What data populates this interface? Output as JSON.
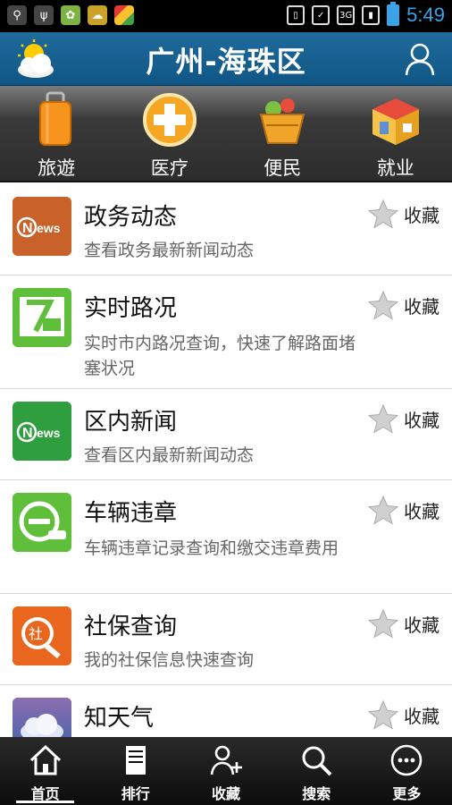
{
  "status_bar": {
    "time": "5:49"
  },
  "header": {
    "title": "广州-海珠区"
  },
  "categories": [
    {
      "label": "旅遊",
      "icon": "luggage-icon"
    },
    {
      "label": "医疗",
      "icon": "medical-cross-icon"
    },
    {
      "label": "便民",
      "icon": "basket-icon"
    },
    {
      "label": "就业",
      "icon": "shop-icon"
    }
  ],
  "list": {
    "fav_label": "收藏",
    "items": [
      {
        "title": "政务动态",
        "desc": "查看政务最新新闻动态",
        "icon": "news-icon",
        "color": "#d2691e"
      },
      {
        "title": "实时路况",
        "desc": "实时市内路况查询，快速了解路面堵塞状况",
        "icon": "traffic-map-icon",
        "color": "#5fbf3a"
      },
      {
        "title": "区内新闻",
        "desc": "查看区内最新新闻动态",
        "icon": "news-icon",
        "color": "#2e9e3e"
      },
      {
        "title": "车辆违章",
        "desc": "车辆违章记录查询和缴交违章费用",
        "icon": "car-violation-icon",
        "color": "#5fbf3a"
      },
      {
        "title": "社保查询",
        "desc": "我的社保信息快速查询",
        "icon": "social-security-icon",
        "color": "#e8661e"
      },
      {
        "title": "知天气",
        "desc": "",
        "icon": "weather-icon",
        "color": "#4a5fa8"
      }
    ]
  },
  "bottom_nav": [
    {
      "label": "首页",
      "icon": "home-icon",
      "active": true
    },
    {
      "label": "排行",
      "icon": "ranking-icon",
      "active": false
    },
    {
      "label": "收藏",
      "icon": "add-user-icon",
      "active": false
    },
    {
      "label": "搜索",
      "icon": "search-icon",
      "active": false
    },
    {
      "label": "更多",
      "icon": "more-icon",
      "active": false
    }
  ]
}
